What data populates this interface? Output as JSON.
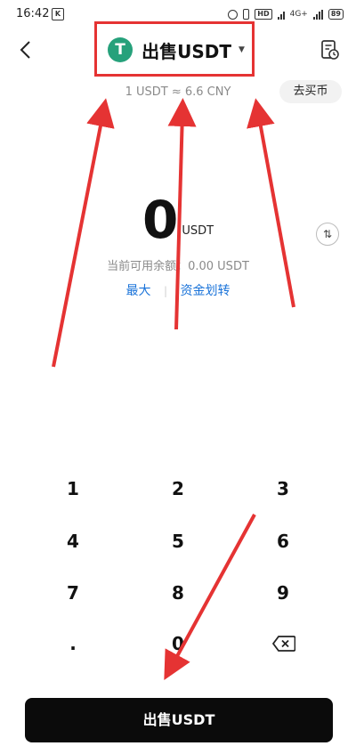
{
  "status_bar": {
    "time": "16:42",
    "hd_label": "HD",
    "network_label": "4G+",
    "battery_level": "89"
  },
  "header": {
    "title": "出售USDT",
    "logo_letter": "T",
    "rate": "1 USDT ≈ 6.6 CNY",
    "buy_link": "去买币"
  },
  "amount": {
    "value": "0",
    "unit": "USDT"
  },
  "balance": {
    "text": "当前可用余额：0.00 USDT"
  },
  "links": {
    "max_label": "最大",
    "transfer_label": "资金划转"
  },
  "keypad": {
    "keys": [
      "1",
      "2",
      "3",
      "4",
      "5",
      "6",
      "7",
      "8",
      "9",
      ".",
      "0"
    ]
  },
  "action": {
    "sell_label": "出售USDT"
  },
  "colors": {
    "annotation_red": "#e53333",
    "tether_green": "#26a17b",
    "link_blue": "#1a73d9",
    "button_black": "#0b0b0b"
  }
}
